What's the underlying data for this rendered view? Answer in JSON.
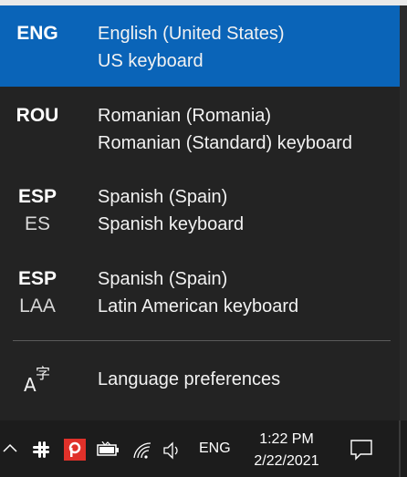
{
  "languages": [
    {
      "code": "ENG",
      "sub": "",
      "name": "English (United States)",
      "keyboard": "US keyboard",
      "selected": true
    },
    {
      "code": "ROU",
      "sub": "",
      "name": "Romanian (Romania)",
      "keyboard": "Romanian (Standard) keyboard",
      "selected": false
    },
    {
      "code": "ESP",
      "sub": "ES",
      "name": "Spanish (Spain)",
      "keyboard": "Spanish keyboard",
      "selected": false
    },
    {
      "code": "ESP",
      "sub": "LAA",
      "name": "Spanish (Spain)",
      "keyboard": "Latin American keyboard",
      "selected": false
    }
  ],
  "preferences": {
    "label": "Language preferences",
    "icon_glyph_a": "A",
    "icon_glyph_char": "字",
    "icon": "language-settings-icon"
  },
  "taskbar": {
    "ime_label": "ENG",
    "time": "1:22 PM",
    "date": "2/22/2021",
    "icons": [
      "chevron-up-icon",
      "slack-icon",
      "pdf-app-icon",
      "battery-icon",
      "wifi-icon",
      "volume-icon",
      "notification-icon"
    ]
  },
  "colors": {
    "accent": "#0a64b8",
    "flyout_bg": "#232323",
    "taskbar_bg": "#1c1c1c",
    "pdf_red": "#e0312a"
  }
}
